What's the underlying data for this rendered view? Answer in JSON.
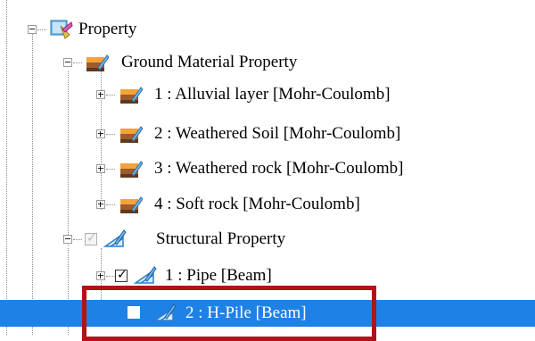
{
  "tree": {
    "root": {
      "label": "Property",
      "icon": "property-icon",
      "expanded": true
    },
    "ground_group": {
      "label": "Ground Material Property",
      "icon": "ground-material-icon",
      "expanded": true,
      "items": [
        {
          "label": "1 : Alluvial layer [Mohr-Coulomb]",
          "icon": "ground-material-icon"
        },
        {
          "label": "2 : Weathered Soil [Mohr-Coulomb]",
          "icon": "ground-material-icon"
        },
        {
          "label": "3 : Weathered rock [Mohr-Coulomb]",
          "icon": "ground-material-icon"
        },
        {
          "label": "4 : Soft rock [Mohr-Coulomb]",
          "icon": "ground-material-icon"
        }
      ]
    },
    "structural_group": {
      "label": "Structural Property",
      "icon": "structural-property-icon",
      "expanded": true,
      "checked": true,
      "items": [
        {
          "label": "1 : Pipe [Beam]",
          "checked": true,
          "expandable": true,
          "icon": "structural-property-icon"
        },
        {
          "label": "2 : H-Pile [Beam]",
          "checked": false,
          "selected": true,
          "icon": "structural-property-icon"
        }
      ]
    }
  },
  "colors": {
    "selection": "#1e81e6",
    "highlight_box": "#b01419",
    "tree_lines": "#8c8c8c"
  }
}
